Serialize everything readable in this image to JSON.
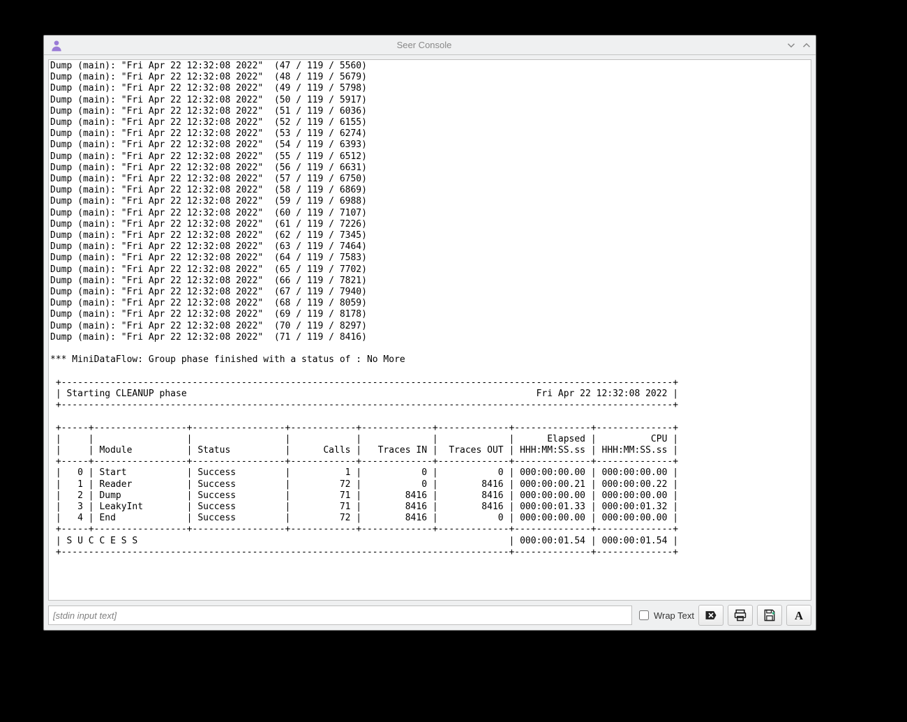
{
  "titlebar": {
    "app_icon_name": "seer-icon",
    "title": "Seer Console",
    "collapse_icon": "chevron-down",
    "expand_icon": "chevron-up"
  },
  "console": {
    "dump_prefix": "Dump (main): \"Fri Apr 22 12:32:08 2022\"  ",
    "dump_lines": [
      "(47 / 119 / 5560)",
      "(48 / 119 / 5679)",
      "(49 / 119 / 5798)",
      "(50 / 119 / 5917)",
      "(51 / 119 / 6036)",
      "(52 / 119 / 6155)",
      "(53 / 119 / 6274)",
      "(54 / 119 / 6393)",
      "(55 / 119 / 6512)",
      "(56 / 119 / 6631)",
      "(57 / 119 / 6750)",
      "(58 / 119 / 6869)",
      "(59 / 119 / 6988)",
      "(60 / 119 / 7107)",
      "(61 / 119 / 7226)",
      "(62 / 119 / 7345)",
      "(63 / 119 / 7464)",
      "(64 / 119 / 7583)",
      "(65 / 119 / 7702)",
      "(66 / 119 / 7821)",
      "(67 / 119 / 7940)",
      "(68 / 119 / 8059)",
      "(69 / 119 / 8178)",
      "(70 / 119 / 8297)",
      "(71 / 119 / 8416)"
    ],
    "status_line": "*** MiniDataFlow: Group phase finished with a status of : No More",
    "phase_header_left": "Starting CLEANUP phase",
    "phase_header_right": "Fri Apr 22 12:32:08 2022",
    "table": {
      "headers_line1": [
        "",
        "",
        "",
        "",
        "",
        "",
        "Elapsed",
        "CPU"
      ],
      "headers_line2": [
        "",
        "Module",
        "Status",
        "Calls",
        "Traces IN",
        "Traces OUT",
        "HHH:MM:SS.ss",
        "HHH:MM:SS.ss"
      ],
      "rows": [
        [
          "0",
          "Start",
          "Success",
          "1",
          "0",
          "0",
          "000:00:00.00",
          "000:00:00.00"
        ],
        [
          "1",
          "Reader",
          "Success",
          "72",
          "0",
          "8416",
          "000:00:00.21",
          "000:00:00.22"
        ],
        [
          "2",
          "Dump",
          "Success",
          "71",
          "8416",
          "8416",
          "000:00:00.00",
          "000:00:00.00"
        ],
        [
          "3",
          "LeakyInt",
          "Success",
          "71",
          "8416",
          "8416",
          "000:00:01.33",
          "000:00:01.32"
        ],
        [
          "4",
          "End",
          "Success",
          "72",
          "8416",
          "0",
          "000:00:00.00",
          "000:00:00.00"
        ]
      ],
      "footer_label": "S U C C E S S",
      "footer_elapsed": "000:00:01.54",
      "footer_cpu": "000:00:01.54"
    }
  },
  "footer": {
    "stdin_placeholder": "[stdin input text]",
    "wrap_label": "Wrap Text",
    "wrap_checked": false,
    "buttons": {
      "clear": "clear-button",
      "print": "print-button",
      "save": "save-button",
      "font": "font-button"
    }
  }
}
